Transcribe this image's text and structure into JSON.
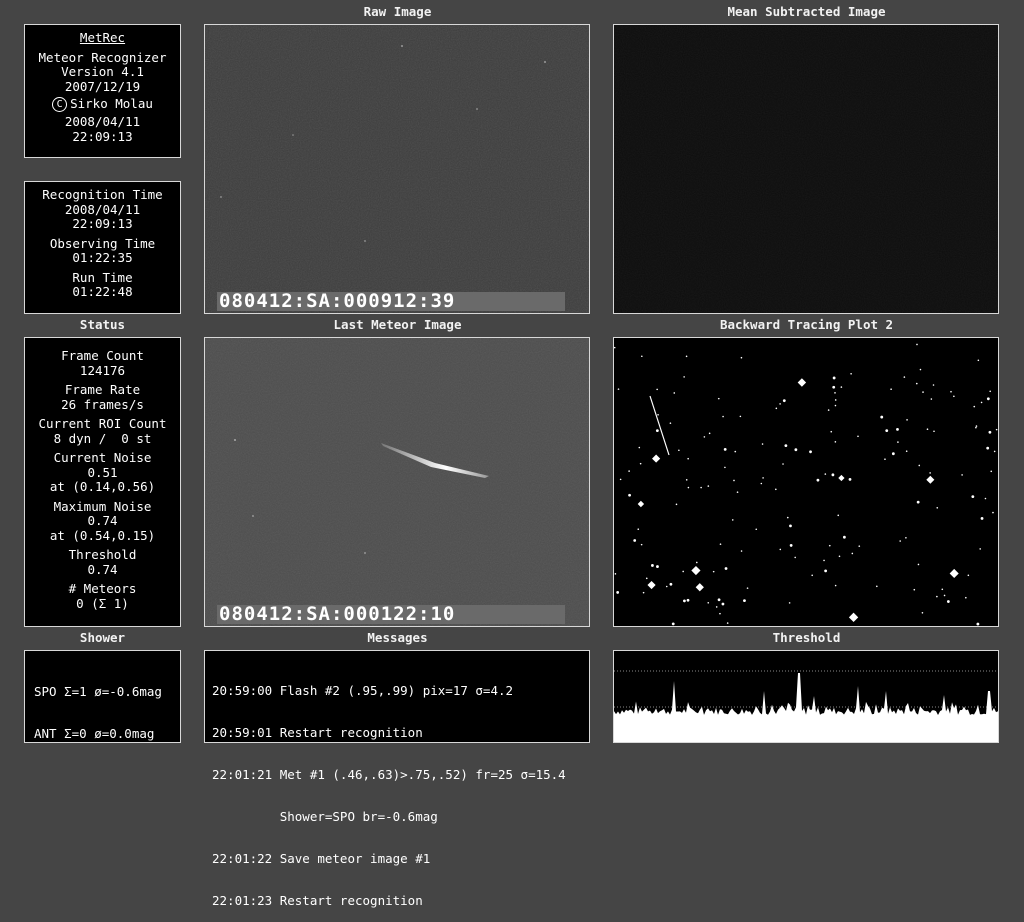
{
  "labels": {
    "raw_image": "Raw Image",
    "mean_subtracted": "Mean Subtracted Image",
    "status": "Status",
    "last_meteor": "Last Meteor Image",
    "backward_tracing": "Backward Tracing Plot 2",
    "shower": "Shower",
    "messages": "Messages",
    "threshold": "Threshold"
  },
  "about": {
    "title": "MetRec",
    "line1": "Meteor Recognizer",
    "line2": "Version 4.1",
    "line3": "2007/12/19",
    "copyright_symbol": "C",
    "author": "Sirko Molau",
    "date": "2008/04/11",
    "time": "22:09:13"
  },
  "timing": {
    "recognition_label": "Recognition Time",
    "recognition_date": "2008/04/11",
    "recognition_time": "22:09:13",
    "observing_label": "Observing Time",
    "observing_time": "01:22:35",
    "run_label": "Run Time",
    "run_time": "01:22:48"
  },
  "status": {
    "frame_count_label": "Frame Count",
    "frame_count": "124176",
    "frame_rate_label": "Frame Rate",
    "frame_rate": "26 frames/s",
    "roi_label": "Current ROI Count",
    "roi_value": "8 dyn /  0 st",
    "noise_label": "Current Noise",
    "noise_value": "0.51",
    "noise_pos": "at (0.14,0.56)",
    "max_noise_label": "Maximum Noise",
    "max_noise_value": "0.74",
    "max_noise_pos": "at (0.54,0.15)",
    "threshold_label": "Threshold",
    "threshold_value": "0.74",
    "meteors_label": "# Meteors",
    "meteors_value": "0 (Σ 1)"
  },
  "raw_timestamp": "080412:SA:000912:39",
  "meteor_timestamp": "080412:SA:000122:10",
  "shower_lines": [
    "SPO Σ=1 ø=-0.6mag",
    "ANT Σ=0 ø=0.0mag"
  ],
  "messages": [
    "20:59:00 Flash #2 (.95,.99) pix=17 σ=4.2",
    "20:59:01 Restart recognition",
    "22:01:21 Met #1 (.46,.63)>.75,.52) fr=25 σ=15.4",
    "         Shower=SPO br=-0.6mag",
    "22:01:22 Save meteor image #1",
    "22:01:23 Restart recognition"
  ],
  "colors": {
    "background": "#454545",
    "panel": "#000000",
    "border": "#d8d8d8",
    "raw_image": "#3c3c3c",
    "meteor_image": "#4c4c4c"
  }
}
